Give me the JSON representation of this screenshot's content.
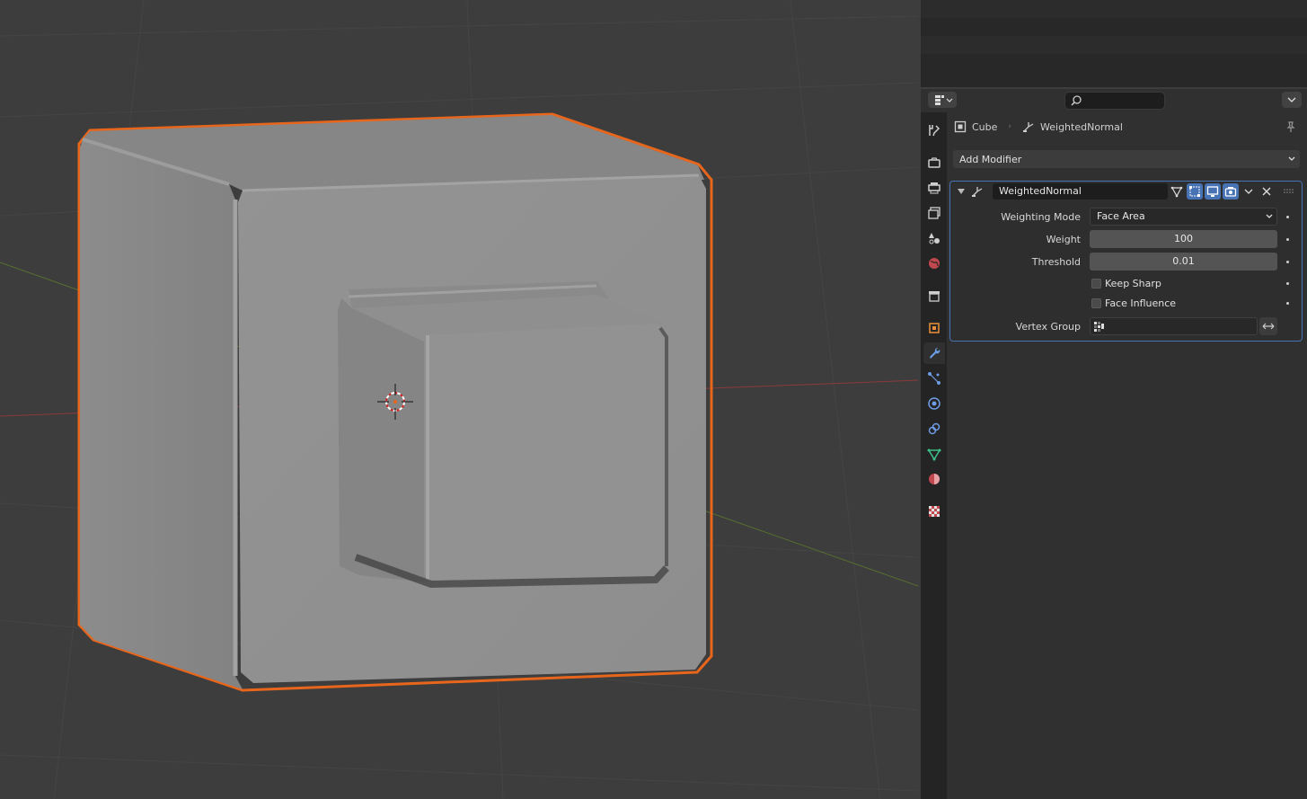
{
  "viewport": {
    "object_name": "Cube",
    "selection_color": "#e8661c",
    "axis_x_color": "#b24a4a",
    "axis_y_color": "#5a7a2e",
    "background_color": "#3d3d3d"
  },
  "properties_editor": {
    "breadcrumb": {
      "object": "Cube",
      "modifier": "WeightedNormal"
    },
    "add_modifier_label": "Add Modifier",
    "tabs": [
      {
        "name": "tool",
        "icon": "wrench-screwdriver-icon"
      },
      {
        "name": "render",
        "icon": "camera-back-icon"
      },
      {
        "name": "output",
        "icon": "printer-icon"
      },
      {
        "name": "view-layer",
        "icon": "images-icon"
      },
      {
        "name": "scene",
        "icon": "scene-cone-sphere-icon"
      },
      {
        "name": "world",
        "icon": "world-icon"
      },
      {
        "name": "collection",
        "icon": "collection-box-icon"
      },
      {
        "name": "object",
        "icon": "object-square-icon"
      },
      {
        "name": "modifiers",
        "icon": "wrench-icon",
        "active": true
      },
      {
        "name": "particles",
        "icon": "particles-icon"
      },
      {
        "name": "physics",
        "icon": "physics-orbit-icon"
      },
      {
        "name": "constraints",
        "icon": "constraint-icon"
      },
      {
        "name": "data",
        "icon": "mesh-triangle-icon"
      },
      {
        "name": "material",
        "icon": "material-sphere-icon"
      },
      {
        "name": "texture",
        "icon": "checker-texture-icon"
      }
    ],
    "modifier": {
      "name": "WeightedNormal",
      "weighting_mode_label": "Weighting Mode",
      "weighting_mode_value": "Face Area",
      "weight_label": "Weight",
      "weight_value": "100",
      "threshold_label": "Threshold",
      "threshold_value": "0.01",
      "keep_sharp_label": "Keep Sharp",
      "keep_sharp_checked": false,
      "face_influence_label": "Face Influence",
      "face_influence_checked": false,
      "vertex_group_label": "Vertex Group",
      "vertex_group_value": ""
    },
    "accent_color": "#4772b3"
  }
}
